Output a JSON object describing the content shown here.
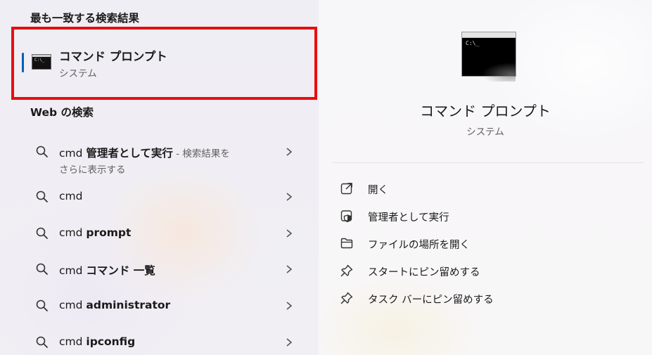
{
  "best_match": {
    "section_title": "最も一致する検索結果",
    "name": "コマンド プロンプト",
    "category": "システム",
    "icon": "command-prompt-icon"
  },
  "web_search": {
    "section_title": "Web の検索",
    "items": [
      {
        "prefix": "cmd ",
        "bold": "管理者として実行",
        "suffix": " - 検索結果を",
        "line2": "さらに表示する"
      },
      {
        "prefix": "cmd",
        "bold": "",
        "suffix": "",
        "line2": ""
      },
      {
        "prefix": "cmd ",
        "bold": "prompt",
        "suffix": "",
        "line2": ""
      },
      {
        "prefix": "cmd ",
        "bold": "コマンド 一覧",
        "suffix": "",
        "line2": ""
      },
      {
        "prefix": "cmd ",
        "bold": "administrator",
        "suffix": "",
        "line2": ""
      },
      {
        "prefix": "cmd ",
        "bold": "ipconfig",
        "suffix": "",
        "line2": ""
      }
    ]
  },
  "detail": {
    "name": "コマンド プロンプト",
    "category": "システム",
    "actions": [
      {
        "label": "開く",
        "icon": "open-external-icon"
      },
      {
        "label": "管理者として実行",
        "icon": "admin-shield-icon"
      },
      {
        "label": "ファイルの場所を開く",
        "icon": "folder-icon"
      },
      {
        "label": "スタートにピン留めする",
        "icon": "pin-icon"
      },
      {
        "label": "タスク バーにピン留めする",
        "icon": "pin-icon"
      }
    ]
  },
  "colors": {
    "highlight_border": "#e50f0f",
    "accent": "#005fb8"
  }
}
